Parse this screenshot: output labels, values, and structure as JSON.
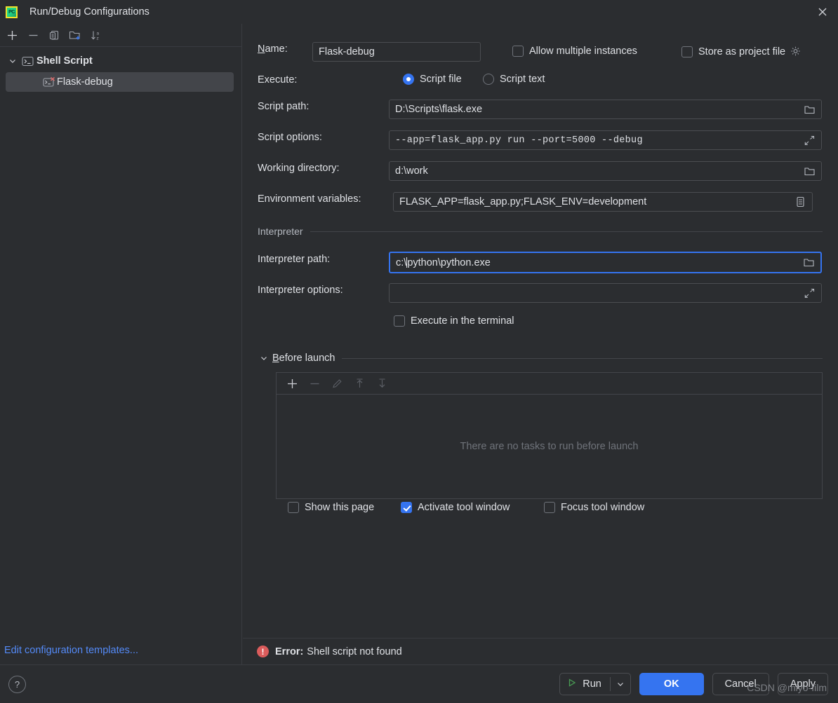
{
  "window": {
    "title": "Run/Debug Configurations",
    "app_icon": "pycharm-logo-icon",
    "app_icon_text": "PC",
    "close_icon": "close-icon"
  },
  "sidebar": {
    "toolbar": [
      {
        "icon": "add-icon",
        "label": "+"
      },
      {
        "icon": "remove-icon",
        "label": "−"
      },
      {
        "icon": "copy-icon",
        "label": "Copy Configuration"
      },
      {
        "icon": "new-folder-icon",
        "label": "New Folder"
      },
      {
        "icon": "sort-alphabetically-icon",
        "label": "Sort Configurations"
      }
    ],
    "tree": {
      "group": {
        "label": "Shell Script",
        "icon": "shell-script-icon",
        "expanded": true,
        "chevron": "chevron-down-icon"
      },
      "items": [
        {
          "label": "Flask-debug",
          "icon": "shell-script-error-icon",
          "selected": true,
          "has_error": true
        }
      ]
    },
    "edit_templates_link": "Edit configuration templates..."
  },
  "form": {
    "name": {
      "label": "Name:",
      "mnemonic": "N",
      "value": "Flask-debug"
    },
    "allow_multiple": {
      "label": "Allow multiple instances",
      "checked": false
    },
    "store_as_project_file": {
      "label": "Store as project file",
      "checked": false,
      "gear_icon": "gear-icon"
    },
    "execute": {
      "label": "Execute:",
      "options": [
        {
          "label": "Script file",
          "selected": true
        },
        {
          "label": "Script text",
          "selected": false
        }
      ]
    },
    "script_path": {
      "label": "Script path:",
      "value": "D:\\Scripts\\flask.exe",
      "button_icon": "folder-icon"
    },
    "script_options": {
      "label": "Script options:",
      "value": "--app=flask_app.py run --port=5000 --debug",
      "button_icon": "expand-icon",
      "mono": true
    },
    "working_directory": {
      "label": "Working directory:",
      "value": "d:\\work",
      "button_icon": "folder-icon"
    },
    "environment_variables": {
      "label": "Environment variables:",
      "value": "FLASK_APP=flask_app.py;FLASK_ENV=development",
      "button_icon": "list-icon"
    },
    "interpreter_section": {
      "label": "Interpreter"
    },
    "interpreter_path": {
      "label": "Interpreter path:",
      "value_before_caret": "c:\\",
      "value_after_caret": "python\\python.exe",
      "button_icon": "folder-icon",
      "focused": true
    },
    "interpreter_options": {
      "label": "Interpreter options:",
      "value": "",
      "placeholder": "",
      "button_icon": "expand-icon"
    },
    "execute_in_terminal": {
      "label": "Execute in the terminal",
      "checked": false
    }
  },
  "before_launch": {
    "title": "Before launch",
    "mnemonic": "B",
    "expanded": true,
    "chevron": "chevron-down-icon",
    "toolbar": [
      {
        "icon": "add-icon",
        "label": "+",
        "enabled": true
      },
      {
        "icon": "remove-icon",
        "label": "−",
        "enabled": false
      },
      {
        "icon": "edit-pencil-icon",
        "label": "Edit",
        "enabled": false
      },
      {
        "icon": "move-up-icon",
        "label": "Move Up",
        "enabled": false
      },
      {
        "icon": "move-down-icon",
        "label": "Move Down",
        "enabled": false
      }
    ],
    "empty_text": "There are no tasks to run before launch",
    "options": [
      {
        "label": "Show this page",
        "checked": false
      },
      {
        "label": "Activate tool window",
        "checked": true
      },
      {
        "label": "Focus tool window",
        "checked": false
      }
    ]
  },
  "error": {
    "icon": "error-icon",
    "prefix": "Error:",
    "message": "Shell script not found"
  },
  "footer": {
    "help_icon": "help-icon",
    "help_label": "?",
    "run_button": {
      "label": "Run",
      "play_icon": "play-icon",
      "dropdown_icon": "chevron-down-icon"
    },
    "ok_button": "OK",
    "cancel_button": "Cancel",
    "apply_button": "Apply"
  },
  "watermark": "CSDN @miyo-film",
  "colors": {
    "background": "#2b2d30",
    "accent_blue": "#3574f0",
    "link_blue": "#548af7",
    "error_red": "#db5c5c",
    "selection": "#43454a",
    "border": "#43454a",
    "run_green": "#499c54"
  }
}
